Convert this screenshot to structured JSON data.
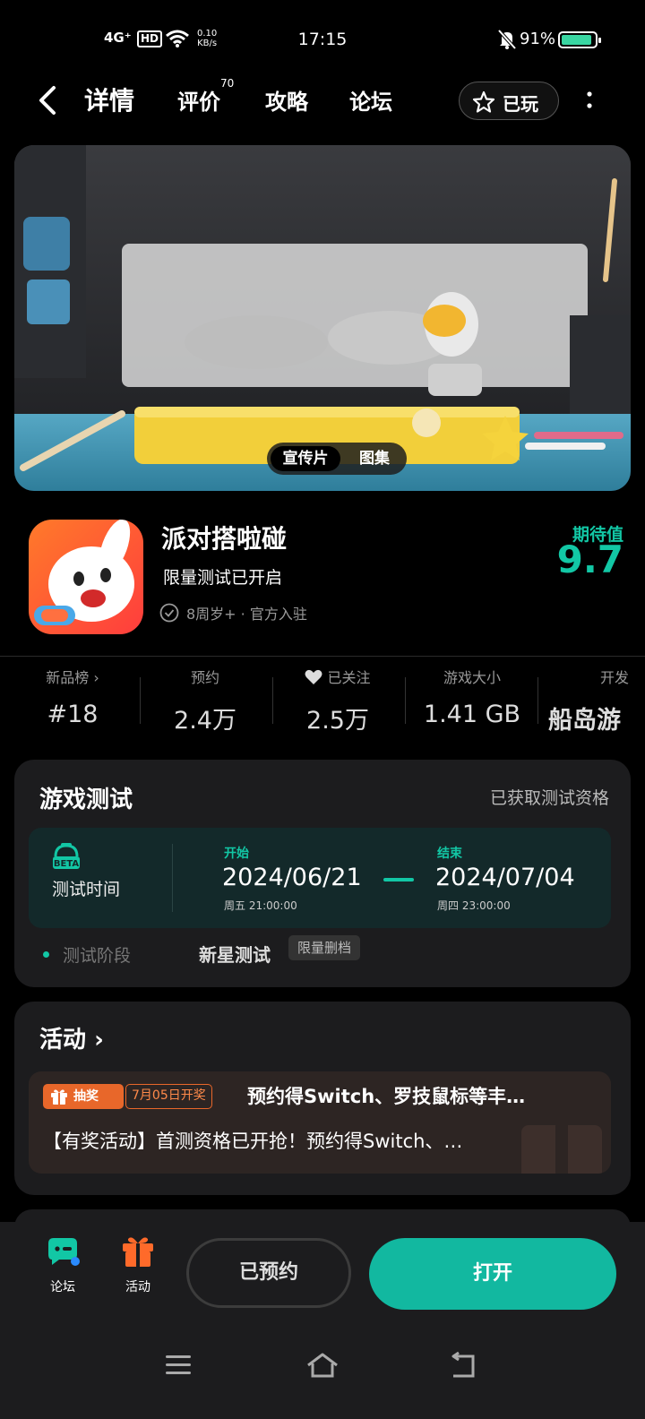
{
  "status_bar": {
    "network": "4G⁺",
    "hd": "HD",
    "speed_value": "0.10",
    "speed_unit": "KB/s",
    "time": "17:15",
    "battery_percent": "91%",
    "battery_level": 0.91
  },
  "nav": {
    "tabs": [
      {
        "label": "详情",
        "active": true
      },
      {
        "label": "评价",
        "badge": "70"
      },
      {
        "label": "攻略"
      },
      {
        "label": "论坛"
      }
    ],
    "played_label": "已玩"
  },
  "hero": {
    "segments": [
      "宣传片",
      "图集"
    ]
  },
  "game": {
    "title": "派对搭啦碰",
    "subtitle": "限量测试已开启",
    "meta": "8周岁+ · 官方入驻",
    "expect_label": "期待值",
    "expect_value": "9.7"
  },
  "stats": [
    {
      "label": "新品榜",
      "value": "#18"
    },
    {
      "label": "预约",
      "value": "2.4万"
    },
    {
      "label": "已关注",
      "value": "2.5万"
    },
    {
      "label": "游戏大小",
      "value": "1.41 GB"
    },
    {
      "label": "开发",
      "value": "船岛游"
    }
  ],
  "test": {
    "title": "游戏测试",
    "qualification": "已获取测试资格",
    "beta_badge": "BETA",
    "time_label": "测试时间",
    "start_label": "开始",
    "start_date": "2024/06/21",
    "start_time": "周五  21:00:00",
    "end_label": "结束",
    "end_date": "2024/07/04",
    "end_time": "周四  23:00:00",
    "phase_label": "测试阶段",
    "phase_value": "新星测试",
    "phase_tag": "限量删档"
  },
  "activity": {
    "title": "活动",
    "tag_lottery": "抽奖",
    "tag_date": "7月05日开奖",
    "headline": "预约得Switch、罗技鼠标等丰…",
    "description": "【有奖活动】首测资格已开抢！预约得Switch、…"
  },
  "bottom_bar": {
    "forum_label": "论坛",
    "activity_label": "活动",
    "reserved_label": "已预约",
    "open_label": "打开"
  },
  "colors": {
    "accent": "#12c7a5",
    "orange": "#e8672a",
    "background": "#000000",
    "card": "#1c1c1e"
  }
}
